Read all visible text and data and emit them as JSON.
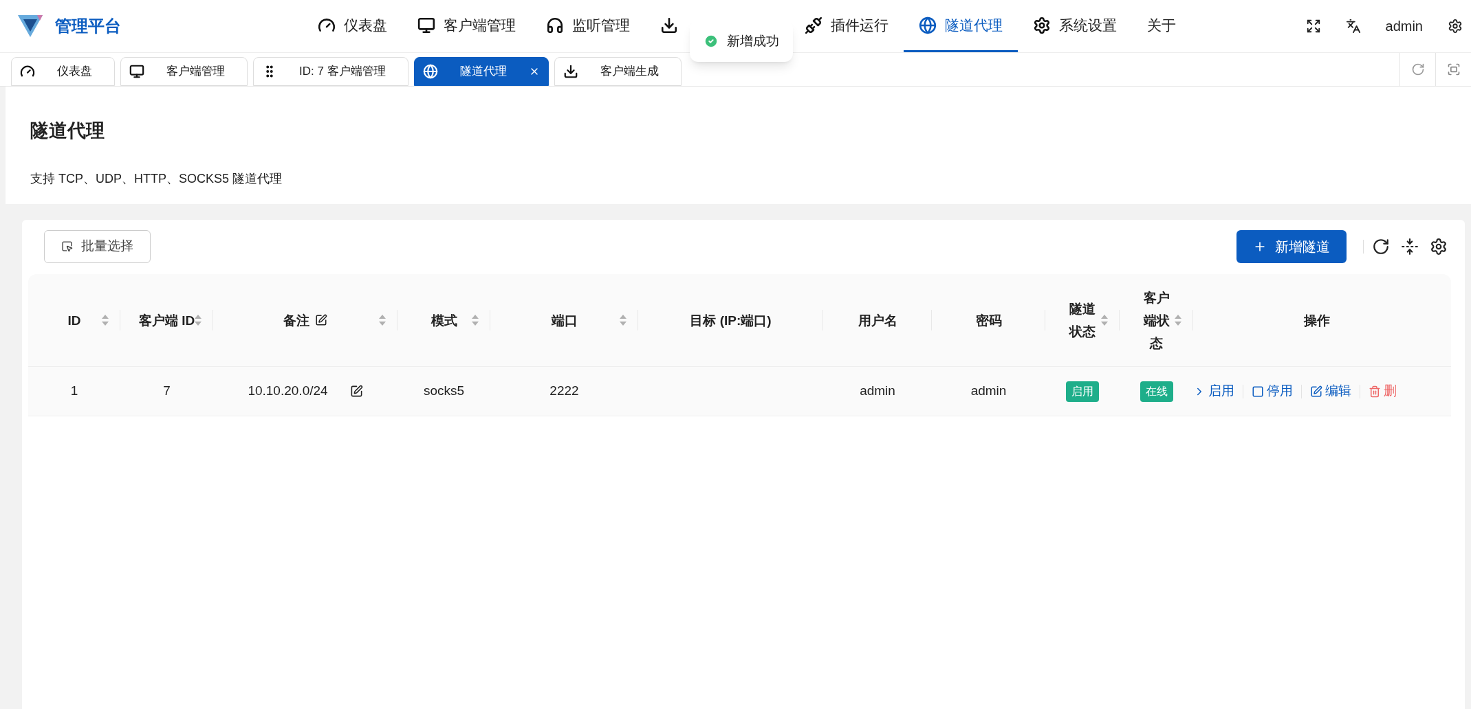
{
  "brand": {
    "title": "管理平台"
  },
  "nav": [
    {
      "label": "仪表盘",
      "selected": false
    },
    {
      "label": "客户端管理",
      "selected": false
    },
    {
      "label": "监听管理",
      "selected": false
    },
    {
      "selected": false
    },
    {
      "label": "插件运行",
      "selected": false
    },
    {
      "label": "隧道代理",
      "selected": true
    },
    {
      "label": "系统设置",
      "selected": false
    },
    {
      "label": "关于",
      "selected": false
    }
  ],
  "user": {
    "name": "admin"
  },
  "toast": {
    "message": "新增成功",
    "kind": "success"
  },
  "tabs": [
    {
      "label": "仪表盘",
      "selected": false,
      "closable": false
    },
    {
      "label": "客户端管理",
      "selected": false,
      "closable": false
    },
    {
      "label": "ID: 7 客户端管理",
      "selected": false,
      "closable": false
    },
    {
      "label": "隧道代理",
      "selected": true,
      "closable": true
    },
    {
      "label": "客户端生成",
      "selected": false,
      "closable": false
    }
  ],
  "page": {
    "title": "隧道代理",
    "description": "支持 TCP、UDP、HTTP、SOCKS5 隧道代理"
  },
  "toolbar": {
    "batch_button": "批量选择",
    "add_button": "新增隧道"
  },
  "table": {
    "columns": [
      {
        "label": "ID",
        "sortable": true
      },
      {
        "label": "客户端 ID",
        "sortable": true
      },
      {
        "label": "备注",
        "sortable": true,
        "editable": true
      },
      {
        "label": "模式",
        "sortable": true
      },
      {
        "label": "端口",
        "sortable": true
      },
      {
        "label": "目标 (IP:端口)",
        "sortable": false
      },
      {
        "label": "用户名",
        "sortable": false
      },
      {
        "label": "密码",
        "sortable": false
      },
      {
        "label": "隧道状态",
        "sortable": true
      },
      {
        "label": "客户端状态",
        "sortable": true
      },
      {
        "label": "操作",
        "sortable": false
      }
    ],
    "rows": [
      {
        "cells": [
          {
            "text": "1"
          },
          {
            "text": "7"
          },
          {
            "text": "10.10.20.0/24",
            "kind": "editable"
          },
          {
            "text": "socks5"
          },
          {
            "text": "2222"
          },
          {
            "text": ""
          },
          {
            "text": "admin"
          },
          {
            "text": "admin"
          },
          {
            "text": "启用",
            "kind": "badge"
          },
          {
            "text": "在线",
            "kind": "badge"
          }
        ],
        "actions": [
          {
            "label": "启用",
            "kind": "enable"
          },
          {
            "label": "停用",
            "kind": "disable"
          },
          {
            "label": "编辑",
            "kind": "edit"
          },
          {
            "label": "删",
            "kind": "delete"
          }
        ]
      }
    ]
  }
}
